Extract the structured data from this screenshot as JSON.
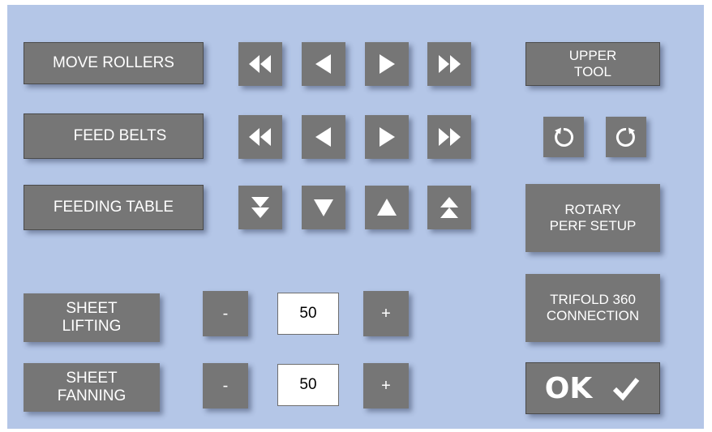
{
  "rows": {
    "move_rollers": {
      "label": "MOVE ROLLERS"
    },
    "feed_belts": {
      "label": "FEED BELTS"
    },
    "feeding_table": {
      "label": "FEEDING TABLE"
    }
  },
  "upper_tool": {
    "label": "UPPER\nTOOL"
  },
  "rotary_perf": {
    "label": "ROTARY\nPERF SETUP"
  },
  "trifold": {
    "label": "TRIFOLD 360\nCONNECTION"
  },
  "sheet_lifting": {
    "label": "SHEET\nLIFTING",
    "minus": "-",
    "plus": "+",
    "value": "50"
  },
  "sheet_fanning": {
    "label": "SHEET\nFANNING",
    "minus": "-",
    "plus": "+",
    "value": "50"
  },
  "ok": {
    "label": "OK"
  },
  "icons": {
    "row1": [
      "fast-left-icon",
      "left-icon",
      "right-icon",
      "fast-right-icon"
    ],
    "row2": [
      "fast-left-icon",
      "left-icon",
      "right-icon",
      "fast-right-icon"
    ],
    "row3": [
      "fast-down-icon",
      "down-icon",
      "up-icon",
      "fast-up-icon"
    ],
    "rotate": [
      "rotate-ccw-icon",
      "rotate-cw-icon"
    ]
  },
  "colors": {
    "background": "#b4c6e7",
    "button": "#767676",
    "text": "#ffffff"
  }
}
